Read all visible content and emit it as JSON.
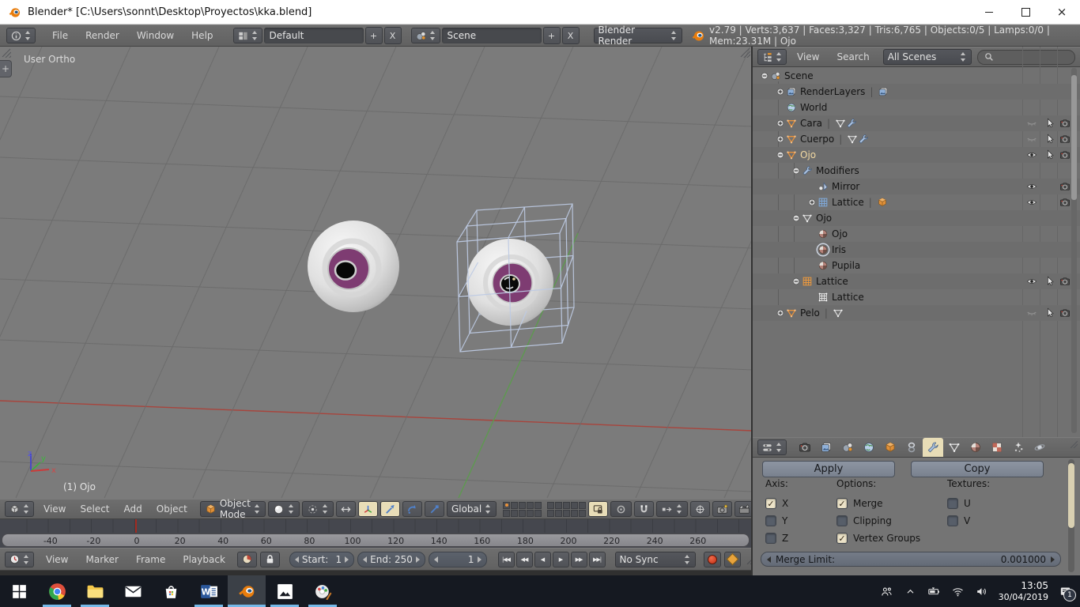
{
  "window": {
    "title": "Blender* [C:\\Users\\sonnt\\Desktop\\Proyectos\\kka.blend]"
  },
  "infobar": {
    "menus": [
      "File",
      "Render",
      "Window",
      "Help"
    ],
    "layout": {
      "value": "Default",
      "add": "+",
      "close": "X"
    },
    "scene": {
      "value": "Scene",
      "add": "+",
      "close": "X"
    },
    "engine": "Blender Render",
    "stats": "v2.79 | Verts:3,637 | Faces:3,327 | Tris:6,765 | Objects:0/5 | Lamps:0/0 | Mem:23.31M | Ojo"
  },
  "viewport": {
    "view_label": "User Ortho",
    "object_label": "(1) Ojo",
    "axes": {
      "x": "x",
      "y": "y",
      "z": "z"
    },
    "header": {
      "menus": [
        "View",
        "Select",
        "Add",
        "Object"
      ],
      "mode": "Object Mode",
      "orientation": "Global"
    }
  },
  "timeline": {
    "ruler": [
      "-40",
      "-20",
      "0",
      "20",
      "40",
      "60",
      "80",
      "100",
      "120",
      "140",
      "160",
      "180",
      "200",
      "220",
      "240",
      "260"
    ],
    "header": {
      "menus": [
        "View",
        "Marker",
        "Frame",
        "Playback"
      ],
      "start_label": "Start:",
      "start_value": "1",
      "end_label": "End:",
      "end_value": "250",
      "frame_value": "1",
      "sync": "No Sync",
      "transport": [
        "jump-start",
        "prev-keyframe",
        "play-reverse",
        "play",
        "next-keyframe",
        "jump-end"
      ]
    }
  },
  "outliner": {
    "menus": [
      "View",
      "Search"
    ],
    "scope": "All Scenes",
    "search_value": "",
    "tree": [
      {
        "label": "Scene",
        "depth": 0,
        "expand": "minus",
        "icon": "scene"
      },
      {
        "label": "RenderLayers",
        "depth": 1,
        "expand": "plus",
        "icon": "renderlayers",
        "extra": [
          "renderlayers"
        ]
      },
      {
        "label": "World",
        "depth": 1,
        "icon": "world"
      },
      {
        "label": "Cara",
        "depth": 1,
        "expand": "plus",
        "icon": "mesh-orange",
        "extra": [
          "mesh-grey",
          "wrench"
        ],
        "eye": "closed",
        "cursor": true,
        "camera": true
      },
      {
        "label": "Cuerpo",
        "depth": 1,
        "expand": "plus",
        "icon": "mesh-orange",
        "extra": [
          "mesh-grey",
          "wrench"
        ],
        "eye": "closed",
        "cursor": true,
        "camera": true
      },
      {
        "label": "Ojo",
        "depth": 1,
        "expand": "minus",
        "icon": "mesh-orange",
        "selected": true,
        "eye": "open",
        "cursor": true,
        "camera": true
      },
      {
        "label": "Modifiers",
        "depth": 2,
        "expand": "minus",
        "icon": "wrench"
      },
      {
        "label": "Mirror",
        "depth": 3,
        "icon": "mirror",
        "eye": "open",
        "camera": true
      },
      {
        "label": "Lattice",
        "depth": 3,
        "expand": "plus",
        "icon": "lattice-blue",
        "extra": [
          "cube-orange"
        ],
        "eye": "open",
        "camera": true
      },
      {
        "label": "Ojo",
        "depth": 2,
        "expand": "minus",
        "icon": "mesh-grey"
      },
      {
        "label": "Ojo",
        "depth": 3,
        "icon": "material"
      },
      {
        "label": "Iris",
        "depth": 3,
        "icon": "material",
        "icon_selected": true
      },
      {
        "label": "Pupila",
        "depth": 3,
        "icon": "material"
      },
      {
        "label": "Lattice",
        "depth": 2,
        "expand": "minus",
        "icon": "lattice-orange",
        "eye": "open",
        "cursor": true,
        "camera": true
      },
      {
        "label": "Lattice",
        "depth": 3,
        "icon": "lattice-grey"
      },
      {
        "label": "Pelo",
        "depth": 1,
        "expand": "plus",
        "icon": "mesh-orange",
        "extra": [
          "mesh-grey"
        ],
        "eye": "closed",
        "cursor": true,
        "camera": true
      }
    ]
  },
  "properties": {
    "tabs": [
      "render",
      "render-layers",
      "scene",
      "world",
      "object",
      "constraints",
      "modifiers",
      "object-data",
      "material",
      "texture",
      "particles",
      "physics"
    ],
    "active_tab": "modifiers",
    "apply_label": "Apply",
    "copy_label": "Copy",
    "groups": [
      {
        "label": "Axis:",
        "items": [
          {
            "label": "X",
            "checked": true
          },
          {
            "label": "Y",
            "checked": false
          },
          {
            "label": "Z",
            "checked": false
          }
        ]
      },
      {
        "label": "Options:",
        "items": [
          {
            "label": "Merge",
            "checked": true
          },
          {
            "label": "Clipping",
            "checked": false
          },
          {
            "label": "Vertex Groups",
            "checked": true
          }
        ]
      },
      {
        "label": "Textures:",
        "items": [
          {
            "label": "U",
            "checked": false
          },
          {
            "label": "V",
            "checked": false
          }
        ]
      }
    ],
    "merge_limit": {
      "label": "Merge Limit:",
      "value": "0.001000"
    }
  },
  "taskbar": {
    "icons": [
      {
        "name": "start",
        "running": false
      },
      {
        "name": "chrome",
        "running": true
      },
      {
        "name": "explorer",
        "running": true
      },
      {
        "name": "mail",
        "running": false
      },
      {
        "name": "store",
        "running": false
      },
      {
        "name": "word",
        "running": true
      },
      {
        "name": "blender",
        "running": true,
        "active": true
      },
      {
        "name": "photos",
        "running": true
      },
      {
        "name": "paint3d",
        "running": true
      }
    ],
    "tray": [
      "people",
      "chevron-up",
      "battery",
      "wifi",
      "volume"
    ],
    "time": "13:05",
    "date": "30/04/2019",
    "notification_badge": "1"
  },
  "colors": {
    "selected_text": "#f2d9a2",
    "lattice_cage": "#becbe4",
    "iris": "#7e3c72",
    "taskbar_underline": "#76b9e8",
    "tab_active_bg": "#e8ddb7"
  }
}
